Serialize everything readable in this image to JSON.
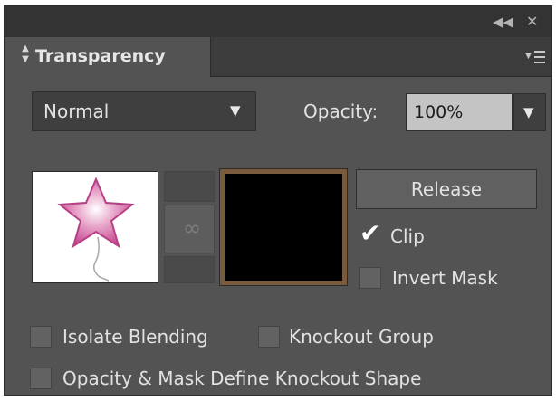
{
  "window": {
    "collapse_icon": "double-chevron-left-icon",
    "close_icon": "close-icon"
  },
  "tab": {
    "label": "Transparency",
    "icon": "expand-collapse-arrows-icon"
  },
  "panel_menu": {
    "icon": "panel-menu-icon"
  },
  "blend_mode": {
    "value": "Normal"
  },
  "opacity": {
    "label": "Opacity:",
    "value": "100%"
  },
  "mask": {
    "artwork_thumbnail": "pink-star-balloon",
    "link_icon": "chain-link-icon",
    "mask_thumbnail": "black-mask"
  },
  "buttons": {
    "release": "Release"
  },
  "options": {
    "clip": {
      "label": "Clip",
      "checked": true
    },
    "invert_mask": {
      "label": "Invert Mask",
      "checked": false
    },
    "isolate_blending": {
      "label": "Isolate Blending",
      "checked": false
    },
    "knockout_group": {
      "label": "Knockout Group",
      "checked": false
    },
    "define_knockout_shape": {
      "label": "Opacity & Mask Define Knockout Shape",
      "checked": false
    }
  },
  "colors": {
    "panel_bg": "#535353",
    "tab_bar_bg": "#3c3c3c",
    "mask_border": "#7a5a3c",
    "star_pink": "#d86aa8"
  }
}
